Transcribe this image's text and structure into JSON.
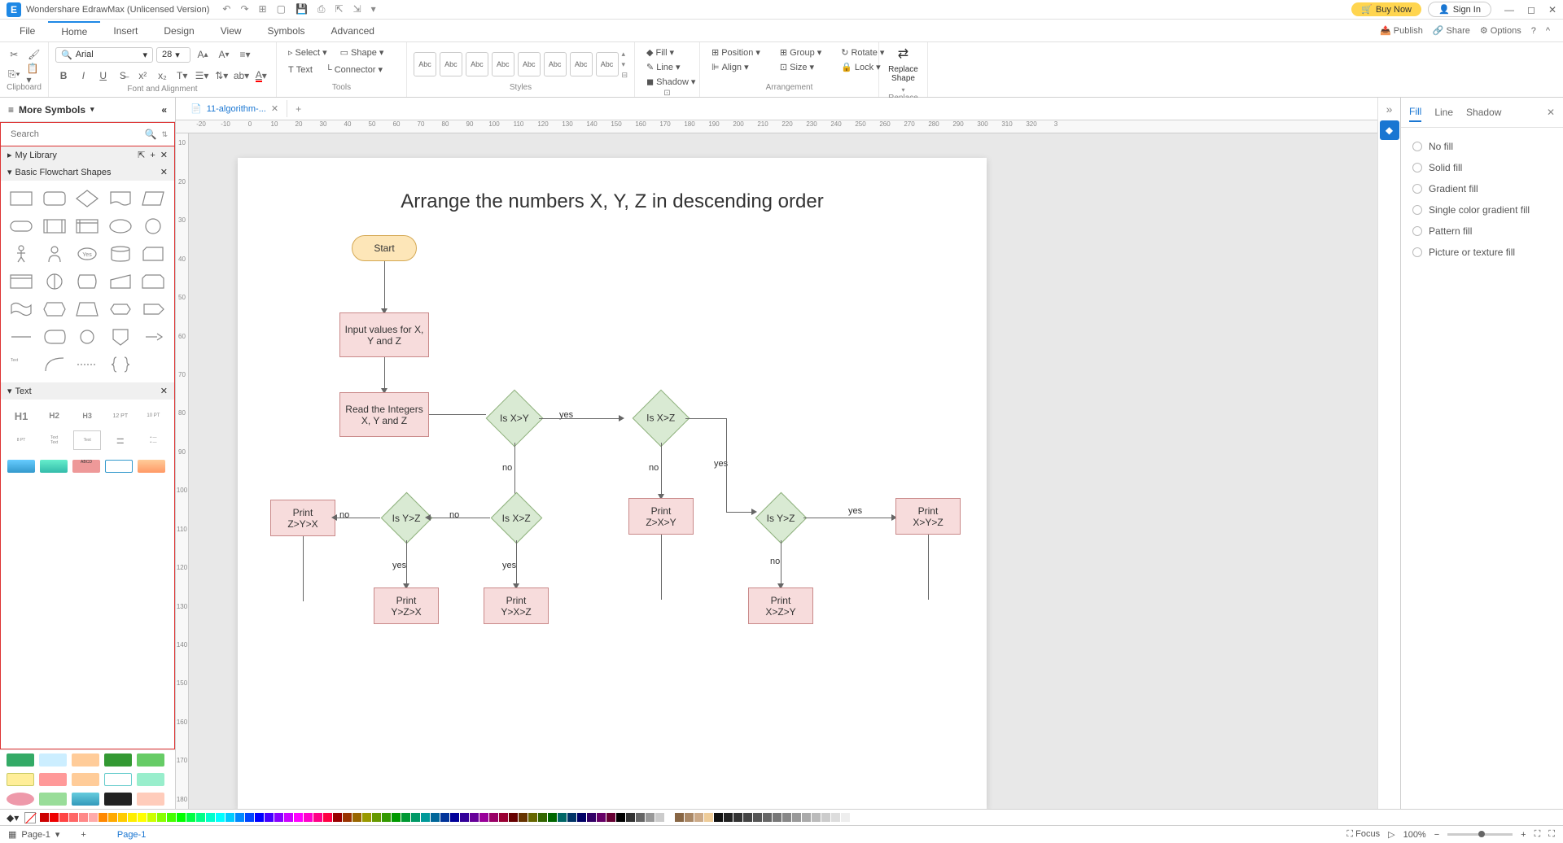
{
  "app": {
    "title": "Wondershare EdrawMax (Unlicensed Version)",
    "buy_now": "Buy Now",
    "sign_in": "Sign In"
  },
  "menu": {
    "file": "File",
    "home": "Home",
    "insert": "Insert",
    "design": "Design",
    "view": "View",
    "symbols": "Symbols",
    "advanced": "Advanced",
    "publish": "Publish",
    "share": "Share",
    "options": "Options"
  },
  "ribbon": {
    "clipboard": "Clipboard",
    "font_alignment": "Font and Alignment",
    "tools": "Tools",
    "styles": "Styles",
    "arrangement": "Arrangement",
    "replace_group": "Replace",
    "font_name": "Arial",
    "font_size": "28",
    "select": "Select",
    "shape": "Shape",
    "text": "Text",
    "connector": "Connector",
    "abc": "Abc",
    "fill": "Fill",
    "line": "Line",
    "shadow": "Shadow",
    "position": "Position",
    "align": "Align",
    "group": "Group",
    "size": "Size",
    "rotate": "Rotate",
    "lock": "Lock",
    "replace_shape": "Replace\nShape"
  },
  "left": {
    "more_symbols": "More Symbols",
    "search_placeholder": "Search",
    "my_library": "My Library",
    "basic_flowchart": "Basic Flowchart Shapes",
    "text_section": "Text",
    "h1": "H1",
    "h2": "H2",
    "h3": "H3"
  },
  "doc": {
    "tab_name": "11-algorithm-..."
  },
  "flowchart": {
    "title": "Arrange the numbers X, Y, Z in descending order",
    "start": "Start",
    "input": "Input values for X, Y and Z",
    "read": "Read the Integers X, Y and Z",
    "is_xy": "Is X>Y",
    "is_xz": "Is X>Z",
    "is_yz": "Is Y>Z",
    "is_xz2": "Is X>Z",
    "is_yz2": "Is Y>Z",
    "print_zyx": "Print\nZ>Y>X",
    "print_zxy": "Print\nZ>X>Y",
    "print_xyz": "Print\nX>Y>Z",
    "print_yzx": "Print\nY>Z>X",
    "print_yxz": "Print\nY>X>Z",
    "print_xzy": "Print\nX>Z>Y",
    "yes": "yes",
    "no": "no"
  },
  "right": {
    "fill": "Fill",
    "line": "Line",
    "shadow": "Shadow",
    "no_fill": "No fill",
    "solid_fill": "Solid fill",
    "gradient_fill": "Gradient fill",
    "single_gradient": "Single color gradient fill",
    "pattern_fill": "Pattern fill",
    "picture_fill": "Picture or texture fill"
  },
  "status": {
    "page_label": "Page-1",
    "page_tab": "Page-1",
    "focus": "Focus",
    "zoom": "100%"
  },
  "ruler_h": [
    "-20",
    "-10",
    "0",
    "10",
    "20",
    "30",
    "40",
    "50",
    "60",
    "70",
    "80",
    "90",
    "100",
    "110",
    "120",
    "130",
    "140",
    "150",
    "160",
    "170",
    "180",
    "190",
    "200",
    "210",
    "220",
    "230",
    "240",
    "250",
    "260",
    "270",
    "280",
    "290",
    "300",
    "310",
    "320",
    "3"
  ],
  "ruler_v": [
    "10",
    "",
    "20",
    "",
    "30",
    "",
    "40",
    "",
    "50",
    "",
    "60",
    "",
    "70",
    "",
    "80",
    "",
    "90",
    "",
    "100",
    "",
    "110",
    "",
    "120",
    "",
    "130",
    "",
    "140",
    "",
    "150",
    "",
    "160",
    "",
    "170",
    "",
    "180"
  ]
}
